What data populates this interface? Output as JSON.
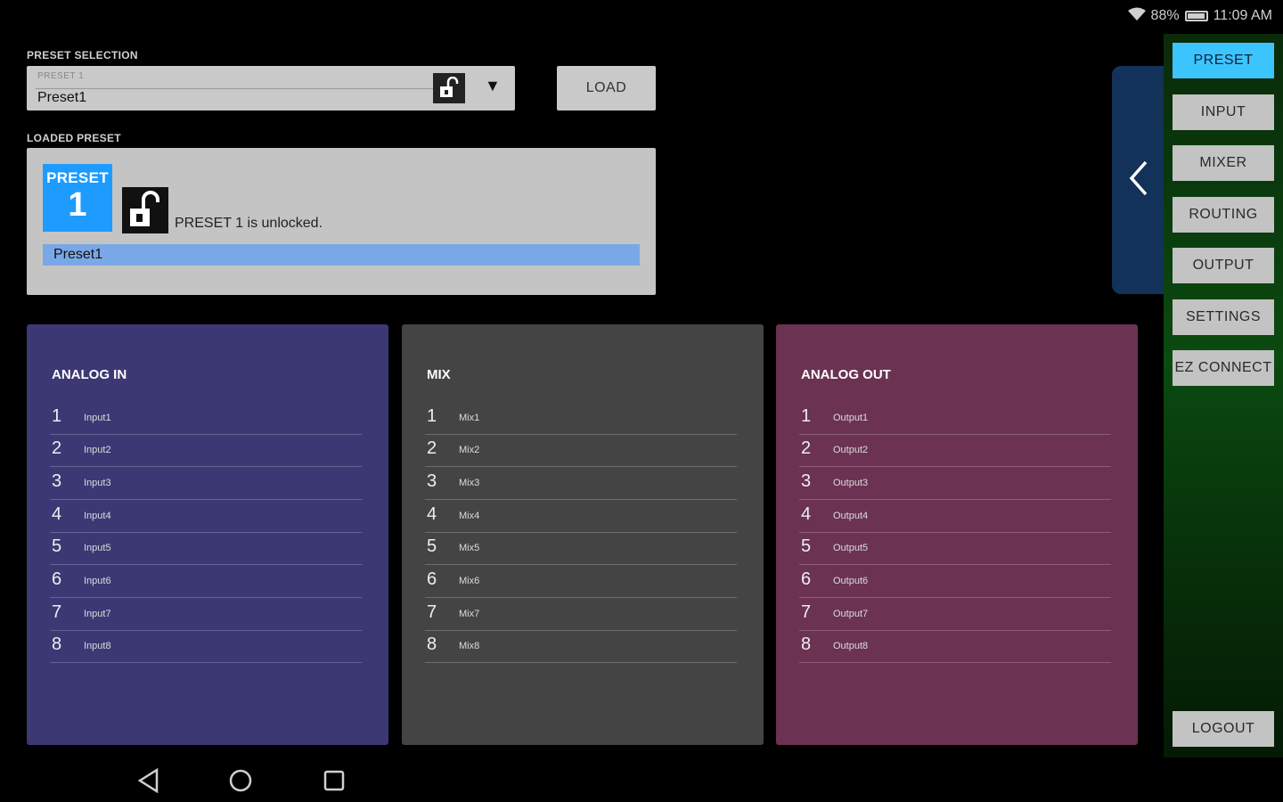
{
  "status_bar": {
    "battery": "88%",
    "time": "11:09 AM",
    "battery_level": 88
  },
  "preset_selection": {
    "label": "PRESET SELECTION",
    "small_label": "PRESET 1",
    "selected": "Preset1",
    "load_label": "LOAD"
  },
  "loaded_preset": {
    "label": "LOADED PRESET",
    "badge_title": "PRESET",
    "badge_number": "1",
    "status": "PRESET 1 is unlocked.",
    "name": "Preset1"
  },
  "nav": {
    "items": [
      "PRESET",
      "INPUT",
      "MIXER",
      "ROUTING",
      "OUTPUT",
      "SETTINGS",
      "EZ CONNECT"
    ],
    "logout": "LOGOUT",
    "active": "PRESET"
  },
  "panels": {
    "analog_in": {
      "title": "ANALOG IN",
      "rows": [
        {
          "n": "1",
          "name": "Input1"
        },
        {
          "n": "2",
          "name": "Input2"
        },
        {
          "n": "3",
          "name": "Input3"
        },
        {
          "n": "4",
          "name": "Input4"
        },
        {
          "n": "5",
          "name": "Input5"
        },
        {
          "n": "6",
          "name": "Input6"
        },
        {
          "n": "7",
          "name": "Input7"
        },
        {
          "n": "8",
          "name": "Input8"
        }
      ]
    },
    "mix": {
      "title": "MIX",
      "rows": [
        {
          "n": "1",
          "name": "Mix1"
        },
        {
          "n": "2",
          "name": "Mix2"
        },
        {
          "n": "3",
          "name": "Mix3"
        },
        {
          "n": "4",
          "name": "Mix4"
        },
        {
          "n": "5",
          "name": "Mix5"
        },
        {
          "n": "6",
          "name": "Mix6"
        },
        {
          "n": "7",
          "name": "Mix7"
        },
        {
          "n": "8",
          "name": "Mix8"
        }
      ]
    },
    "analog_out": {
      "title": "ANALOG OUT",
      "rows": [
        {
          "n": "1",
          "name": "Output1"
        },
        {
          "n": "2",
          "name": "Output2"
        },
        {
          "n": "3",
          "name": "Output3"
        },
        {
          "n": "4",
          "name": "Output4"
        },
        {
          "n": "5",
          "name": "Output5"
        },
        {
          "n": "6",
          "name": "Output6"
        },
        {
          "n": "7",
          "name": "Output7"
        },
        {
          "n": "8",
          "name": "Output8"
        }
      ]
    }
  },
  "colors": {
    "accent": "#3cc4ff",
    "badge": "#1e9bff",
    "analog_in": "#3c3874",
    "mix": "#444444",
    "analog_out": "#6b3252"
  },
  "icons": [
    "wifi-icon",
    "battery-icon",
    "lock-open-icon",
    "dropdown-arrow-icon",
    "chevron-left-icon",
    "back-icon",
    "home-icon",
    "recents-icon"
  ]
}
